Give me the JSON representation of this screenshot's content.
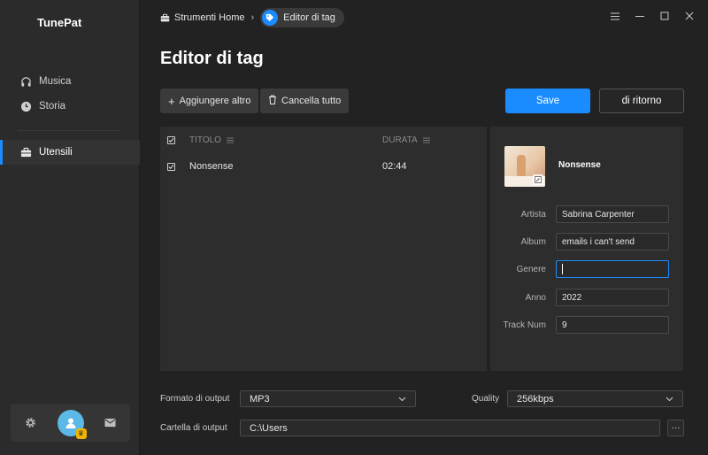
{
  "app": {
    "name": "TunePat"
  },
  "sidebar": {
    "items": [
      {
        "label": "Musica",
        "icon": "headphones-icon"
      },
      {
        "label": "Storia",
        "icon": "clock-icon"
      },
      {
        "label": "Utensili",
        "icon": "toolbox-icon",
        "active": true
      }
    ]
  },
  "breadcrumb": {
    "home": "Strumenti Home",
    "current": "Editor di tag"
  },
  "page": {
    "title": "Editor di tag"
  },
  "toolbar": {
    "add_label": "Aggiungere altro",
    "clear_label": "Cancella tutto",
    "save_label": "Save",
    "back_label": "di ritorno"
  },
  "tracks": {
    "headers": {
      "title": "TITOLO",
      "duration": "DURATA"
    },
    "rows": [
      {
        "title": "Nonsense",
        "duration": "02:44",
        "checked": true
      }
    ]
  },
  "tags": {
    "song_title": "Nonsense",
    "fields": [
      {
        "label": "Artista",
        "value": "Sabrina Carpenter"
      },
      {
        "label": "Album",
        "value": "emails i can't send"
      },
      {
        "label": "Genere",
        "value": ""
      },
      {
        "label": "Anno",
        "value": "2022"
      },
      {
        "label": "Track Num",
        "value": "9"
      }
    ]
  },
  "output": {
    "format_label": "Formato di output",
    "format_value": "MP3",
    "quality_label": "Quality",
    "quality_value": "256kbps",
    "folder_label": "Cartella di output",
    "folder_value": "C:\\Users",
    "browse_label": "···"
  },
  "colors": {
    "accent": "#1a8cff",
    "background": "#222222",
    "panel": "#2d2d2d"
  }
}
